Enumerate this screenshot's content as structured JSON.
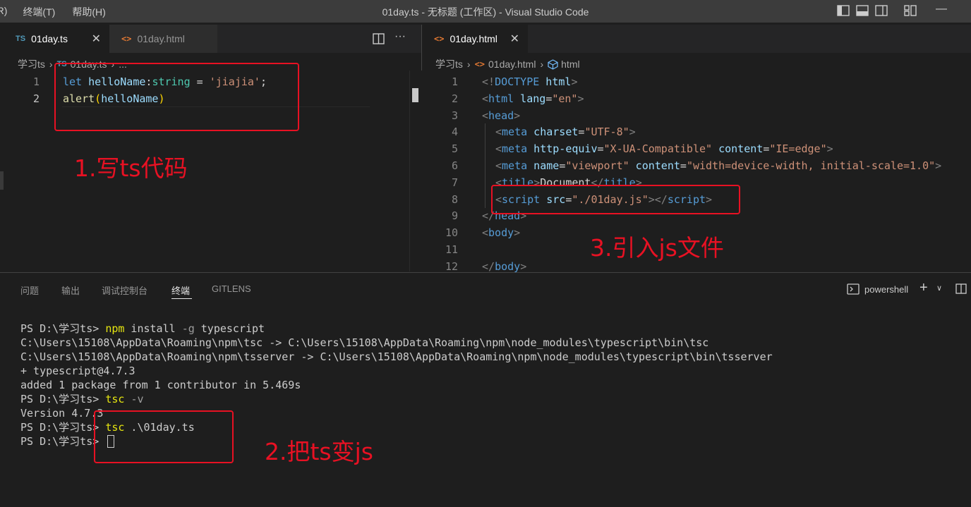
{
  "titlebar": {
    "menu": [
      "(R)",
      "终端(T)",
      "帮助(H)"
    ],
    "title": "01day.ts - 无标题 (工作区) - Visual Studio Code",
    "minimize": "—"
  },
  "left_editor": {
    "tabs": [
      {
        "icon": "TS",
        "label": "01day.ts",
        "active": true,
        "close": "✕"
      },
      {
        "icon": "<>",
        "label": "01day.html",
        "active": false
      }
    ],
    "more": "···",
    "breadcrumb": {
      "folder": "学习ts",
      "file_icon": "TS",
      "file": "01day.ts",
      "tail": "..."
    },
    "lines": [
      {
        "n": "1",
        "tokens": [
          [
            "kw",
            "let "
          ],
          [
            "var",
            "helloName"
          ],
          [
            "txt",
            ":"
          ],
          [
            "type",
            "string"
          ],
          [
            "txt",
            " = "
          ],
          [
            "str",
            "'jiajia'"
          ],
          [
            "txt",
            ";"
          ]
        ]
      },
      {
        "n": "2",
        "tokens": [
          [
            "fn",
            "alert"
          ],
          [
            "bracket",
            "("
          ],
          [
            "var",
            "helloName"
          ],
          [
            "bracket",
            ")"
          ]
        ]
      }
    ]
  },
  "right_editor": {
    "tab": {
      "icon": "<>",
      "label": "01day.html",
      "close": "✕"
    },
    "breadcrumb": {
      "folder": "学习ts",
      "file_icon": "<>",
      "file": "01day.html",
      "node": "html"
    },
    "lines": [
      {
        "n": "1",
        "indent": 0,
        "tokens": [
          [
            "punc",
            "<!"
          ],
          [
            "tag",
            "DOCTYPE"
          ],
          [
            "attr",
            " html"
          ],
          [
            "punc",
            ">"
          ]
        ]
      },
      {
        "n": "2",
        "indent": 0,
        "tokens": [
          [
            "punc",
            "<"
          ],
          [
            "tag",
            "html"
          ],
          [
            "attr",
            " lang"
          ],
          [
            "txt",
            "="
          ],
          [
            "str",
            "\"en\""
          ],
          [
            "punc",
            ">"
          ]
        ]
      },
      {
        "n": "3",
        "indent": 0,
        "tokens": [
          [
            "punc",
            "<"
          ],
          [
            "tag",
            "head"
          ],
          [
            "punc",
            ">"
          ]
        ]
      },
      {
        "n": "4",
        "indent": 1,
        "tokens": [
          [
            "punc",
            "<"
          ],
          [
            "tag",
            "meta"
          ],
          [
            "attr",
            " charset"
          ],
          [
            "txt",
            "="
          ],
          [
            "str",
            "\"UTF-8\""
          ],
          [
            "punc",
            ">"
          ]
        ]
      },
      {
        "n": "5",
        "indent": 1,
        "tokens": [
          [
            "punc",
            "<"
          ],
          [
            "tag",
            "meta"
          ],
          [
            "attr",
            " http-equiv"
          ],
          [
            "txt",
            "="
          ],
          [
            "str",
            "\"X-UA-Compatible\""
          ],
          [
            "attr",
            " content"
          ],
          [
            "txt",
            "="
          ],
          [
            "str",
            "\"IE=edge\""
          ],
          [
            "punc",
            ">"
          ]
        ]
      },
      {
        "n": "6",
        "indent": 1,
        "tokens": [
          [
            "punc",
            "<"
          ],
          [
            "tag",
            "meta"
          ],
          [
            "attr",
            " name"
          ],
          [
            "txt",
            "="
          ],
          [
            "str",
            "\"viewport\""
          ],
          [
            "attr",
            " content"
          ],
          [
            "txt",
            "="
          ],
          [
            "str",
            "\"width=device-width, initial-scale=1.0\""
          ],
          [
            "punc",
            ">"
          ]
        ]
      },
      {
        "n": "7",
        "indent": 1,
        "tokens": [
          [
            "punc",
            "<"
          ],
          [
            "tag",
            "title"
          ],
          [
            "punc",
            ">"
          ],
          [
            "txt",
            "Document"
          ],
          [
            "punc",
            "</"
          ],
          [
            "tag",
            "title"
          ],
          [
            "punc",
            ">"
          ]
        ]
      },
      {
        "n": "8",
        "indent": 1,
        "tokens": [
          [
            "punc",
            "<"
          ],
          [
            "tag",
            "script"
          ],
          [
            "attr",
            " src"
          ],
          [
            "txt",
            "="
          ],
          [
            "str",
            "\"./01day.js\""
          ],
          [
            "punc",
            "></"
          ],
          [
            "tag",
            "script"
          ],
          [
            "punc",
            ">"
          ]
        ]
      },
      {
        "n": "9",
        "indent": 0,
        "tokens": [
          [
            "punc",
            "</"
          ],
          [
            "tag",
            "head"
          ],
          [
            "punc",
            ">"
          ]
        ]
      },
      {
        "n": "10",
        "indent": 0,
        "tokens": [
          [
            "punc",
            "<"
          ],
          [
            "tag",
            "body"
          ],
          [
            "punc",
            ">"
          ]
        ]
      },
      {
        "n": "11",
        "indent": 0,
        "tokens": []
      },
      {
        "n": "12",
        "indent": 0,
        "tokens": [
          [
            "punc",
            "</"
          ],
          [
            "tag",
            "body"
          ],
          [
            "punc",
            ">"
          ]
        ]
      }
    ]
  },
  "panel": {
    "tabs": [
      "问题",
      "输出",
      "调试控制台",
      "终端",
      "GITLENS"
    ],
    "active_tab": "终端",
    "shell": "powershell",
    "add": "+",
    "terminal_lines": [
      [
        [
          "",
          "PS D:\\学习ts> "
        ],
        [
          "ty",
          "npm"
        ],
        [
          "",
          " install "
        ],
        [
          "tg",
          "-g"
        ],
        [
          "",
          " typescript"
        ]
      ],
      [
        [
          "",
          "C:\\Users\\15108\\AppData\\Roaming\\npm\\tsc -> C:\\Users\\15108\\AppData\\Roaming\\npm\\node_modules\\typescript\\bin\\tsc"
        ]
      ],
      [
        [
          "",
          "C:\\Users\\15108\\AppData\\Roaming\\npm\\tsserver -> C:\\Users\\15108\\AppData\\Roaming\\npm\\node_modules\\typescript\\bin\\tsserver"
        ]
      ],
      [
        [
          "",
          "+ typescript@4.7.3"
        ]
      ],
      [
        [
          "",
          "added 1 package from 1 contributor in 5.469s"
        ]
      ],
      [
        [
          "",
          "PS D:\\学习ts> "
        ],
        [
          "ty",
          "tsc"
        ],
        [
          "",
          " "
        ],
        [
          "tg",
          "-v"
        ]
      ],
      [
        [
          "",
          "Version 4.7.3"
        ]
      ],
      [
        [
          "",
          "PS D:\\学习ts> "
        ],
        [
          "ty",
          "tsc"
        ],
        [
          "",
          " .\\01day.ts"
        ]
      ],
      [
        [
          "",
          "PS D:\\学习ts> "
        ]
      ]
    ]
  },
  "annotations": {
    "step1": "1.写ts代码",
    "step2": "2.把ts变js",
    "step3": "3.引入js文件"
  }
}
